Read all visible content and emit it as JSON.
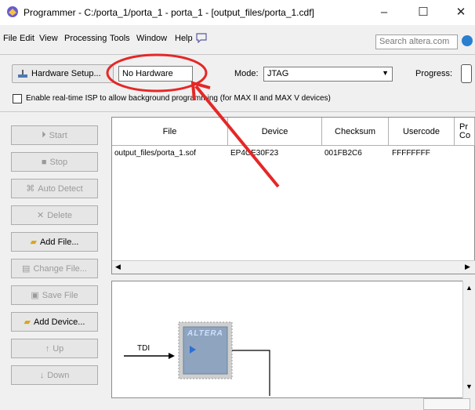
{
  "window": {
    "title": "Programmer - C:/porta_1/porta_1 - porta_1 - [output_files/porta_1.cdf]",
    "minimize": "–",
    "maximize": "☐",
    "close": "✕"
  },
  "menu": {
    "items": [
      "File",
      "Edit",
      "View",
      "Processing",
      "Tools",
      "Window",
      "Help"
    ],
    "search_placeholder": "Search altera.com"
  },
  "toolbar": {
    "hardware_setup_label": "Hardware Setup...",
    "hardware_value": "No Hardware",
    "mode_label": "Mode:",
    "mode_value": "JTAG",
    "progress_label": "Progress:",
    "isp_checkbox_label": "Enable real-time ISP to allow background programming (for MAX II and MAX V devices)",
    "isp_checked": false
  },
  "side_buttons": [
    {
      "label": "Start",
      "enabled": false
    },
    {
      "label": "Stop",
      "enabled": false
    },
    {
      "label": "Auto Detect",
      "enabled": false
    },
    {
      "label": "Delete",
      "enabled": false
    },
    {
      "label": "Add File...",
      "enabled": true
    },
    {
      "label": "Change File...",
      "enabled": false
    },
    {
      "label": "Save File",
      "enabled": false
    },
    {
      "label": "Add Device...",
      "enabled": true
    },
    {
      "label": "Up",
      "enabled": false
    },
    {
      "label": "Down",
      "enabled": false
    }
  ],
  "table": {
    "columns": [
      "File",
      "Device",
      "Checksum",
      "Usercode",
      "Pr Co"
    ],
    "rows": [
      {
        "file": "output_files/porta_1.sof",
        "device": "EP4CE30F23",
        "checksum": "001FB2C6",
        "usercode": "FFFFFFFF"
      }
    ]
  },
  "diagram": {
    "tdi_label": "TDI",
    "chip_logo": "ALTERA"
  },
  "annotation": {
    "circle_color": "#e52727",
    "arrow_color": "#e52727"
  }
}
